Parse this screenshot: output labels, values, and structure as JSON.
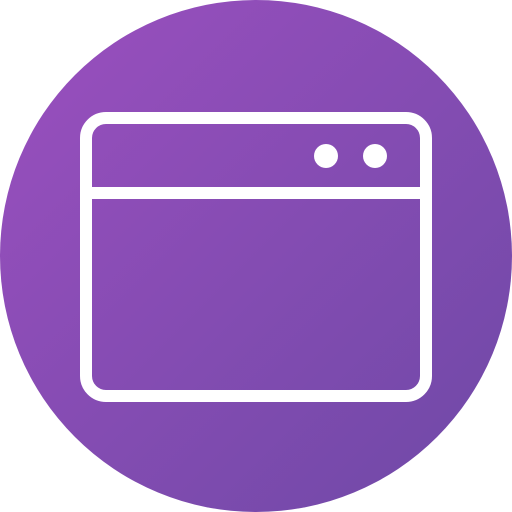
{
  "icon": {
    "name": "browser-window-icon",
    "background_shape": "circle",
    "gradient_start": "#9B4FBF",
    "gradient_end": "#6E49A6",
    "stroke_color": "#FFFFFF",
    "window_controls": [
      "control-dot",
      "control-dot"
    ]
  }
}
